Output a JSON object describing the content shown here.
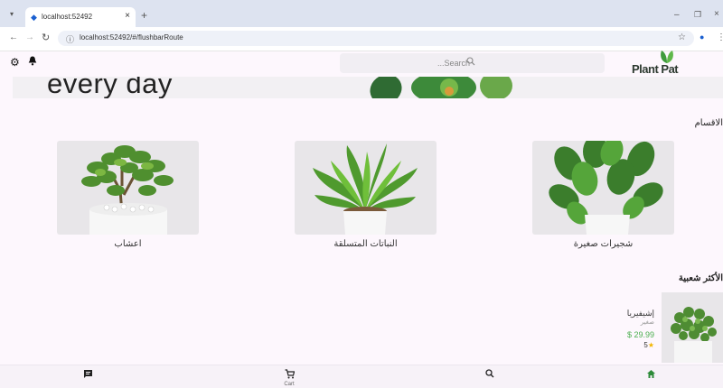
{
  "browser": {
    "tab_title": "localhost:52492",
    "url": "localhost:52492/#/flushbarRoute",
    "icons": [
      "tab-dropdown-icon",
      "favicon-icon",
      "close-icon",
      "new-tab-icon",
      "minimize-icon",
      "maximize-icon",
      "window-close-icon",
      "back-icon",
      "forward-icon",
      "reload-icon",
      "site-info-icon",
      "star-icon",
      "profile-icon",
      "menu-icon"
    ]
  },
  "header": {
    "search_placeholder": "...Search",
    "logo_text": "Plant Pat",
    "icons": [
      "gear-icon",
      "bell-icon",
      "search-icon"
    ]
  },
  "banner": {
    "text": "every day"
  },
  "categories": {
    "title": "الاقسام",
    "items": [
      {
        "label": "اعشاب"
      },
      {
        "label": "النباتات المتسلقة"
      },
      {
        "label": "شجيرات صغيرة"
      }
    ]
  },
  "popular": {
    "title": "الأكثر شعبية",
    "product": {
      "name": "إشيفيريا",
      "category": "صغير",
      "price": "$ 29.99",
      "rating": "5"
    }
  },
  "bottom_nav": {
    "cart_label": "Cart",
    "icons": [
      "chat-icon",
      "cart-icon",
      "search-icon",
      "home-icon"
    ],
    "colors": {
      "active": "#2e8b3a"
    }
  },
  "colors": {
    "background": "#fdf7fd",
    "price": "#4caf50",
    "star": "#f2b600"
  }
}
